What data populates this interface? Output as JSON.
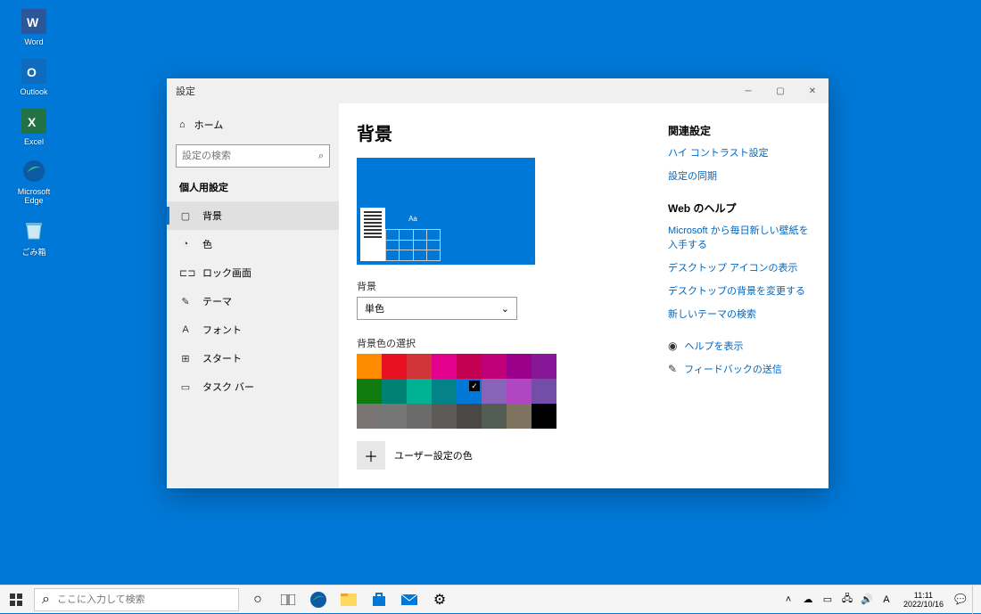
{
  "desktop": {
    "icons": [
      {
        "label": "Word",
        "key": "word"
      },
      {
        "label": "Outlook",
        "key": "outlook"
      },
      {
        "label": "Excel",
        "key": "excel"
      },
      {
        "label": "Microsoft Edge",
        "key": "edge"
      },
      {
        "label": "ごみ箱",
        "key": "recycle"
      }
    ]
  },
  "window": {
    "title": "設定",
    "home_label": "ホーム",
    "search_placeholder": "設定の検索",
    "section": "個人用設定",
    "nav": [
      {
        "label": "背景",
        "icon": "image",
        "active": true
      },
      {
        "label": "色",
        "icon": "palette"
      },
      {
        "label": "ロック画面",
        "icon": "lock"
      },
      {
        "label": "テーマ",
        "icon": "brush"
      },
      {
        "label": "フォント",
        "icon": "font"
      },
      {
        "label": "スタート",
        "icon": "start"
      },
      {
        "label": "タスク バー",
        "icon": "taskbar"
      }
    ]
  },
  "page": {
    "title": "背景",
    "bg_label": "背景",
    "bg_value": "単色",
    "color_label": "背景色の選択",
    "custom_label": "ユーザー設定の色",
    "colors_row1": [
      "#ff8c00",
      "#e81123",
      "#d13438",
      "#e3008c",
      "#c30052",
      "#bf0077",
      "#9a0089",
      "#881798"
    ],
    "colors_row2": [
      "#107c10",
      "#008272",
      "#00b294",
      "#038387",
      "#0078d7",
      "#8764b8",
      "#b146c2",
      "#744da9"
    ],
    "colors_row3": [
      "#7a7574",
      "#767676",
      "#6b6b6b",
      "#5d5a58",
      "#4a4846",
      "#525e54",
      "#7e735f",
      "#000000"
    ],
    "selected_index": 12
  },
  "side": {
    "related_heading": "関連設定",
    "related": [
      "ハイ コントラスト設定",
      "設定の同期"
    ],
    "web_heading": "Web のヘルプ",
    "web": [
      "Microsoft から毎日新しい壁紙を入手する",
      "デスクトップ アイコンの表示",
      "デスクトップの背景を変更する",
      "新しいテーマの検索"
    ],
    "help": "ヘルプを表示",
    "feedback": "フィードバックの送信"
  },
  "taskbar": {
    "search_placeholder": "ここに入力して検索",
    "time": "11:11",
    "date": "2022/10/16",
    "ime": "A"
  }
}
